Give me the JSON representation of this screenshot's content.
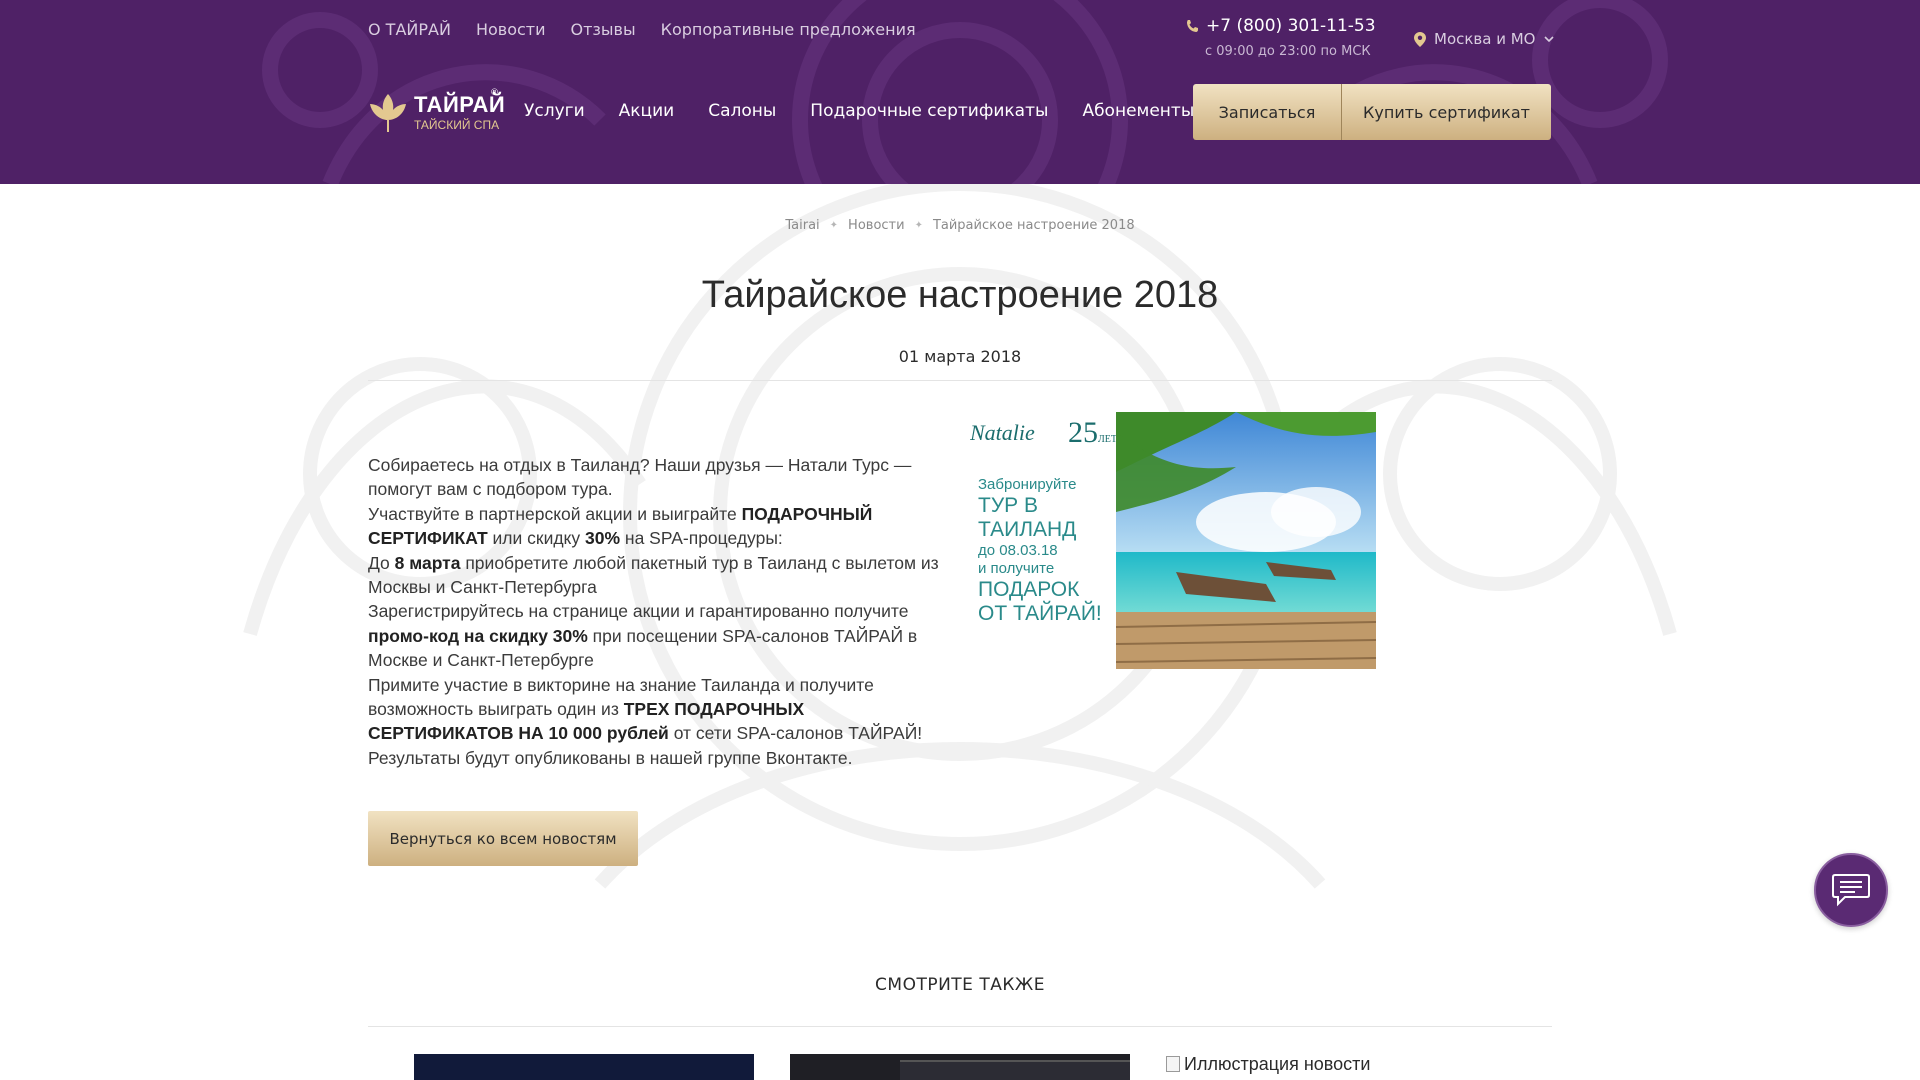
{
  "topnav": {
    "items": [
      "О ТАЙРАЙ",
      "Новости",
      "Отзывы",
      "Корпоративные предложения"
    ]
  },
  "contact": {
    "phone": "+7 (800) 301-11-53",
    "hours": "с 09:00 до 23:00 по МСК",
    "region": "Москва и МО"
  },
  "logo": {
    "title": "ТАЙРАЙ",
    "subtitle": "ТАЙСКИЙ СПА",
    "reg": "®"
  },
  "mainnav": {
    "items": [
      "Услуги",
      "Акции",
      "Салоны",
      "Подарочные сертификаты",
      "Абонементы"
    ]
  },
  "cta": {
    "signup": "Записаться",
    "buy": "Купить сертификат"
  },
  "breadcrumb": {
    "items": [
      "Tairai",
      "Новости",
      "Тайрайское настроение 2018"
    ],
    "separator": "✦"
  },
  "article": {
    "title": "Тайрайское настроение 2018",
    "date": "01 марта 2018",
    "p1": "Собираетесь на отдых в Таиланд? Наши друзья — Натали Турс — помогут вам с подбором тура.",
    "p2_a": "Участвуйте в партнерской акции и выиграйте ",
    "p2_b": "ПОДАРОЧНЫЙ СЕРТИФИКАТ",
    "p2_c": " или скидку ",
    "p2_d": "30%",
    "p2_e": " на SPA-процедуры:",
    "p3_a": "До ",
    "p3_b": "8 марта",
    "p3_c": " приобретите любой пакетный тур в Таиланд с вылетом из Москвы и Санкт-Петербурга",
    "p4_a": "Зарегистрируйтесь на странице акции и гарантированно получите ",
    "p4_b": "промо-код на скидку 30%",
    "p4_c": " при посещении SPA-салонов ТАЙРАЙ в Москве и Санкт-Петербурге",
    "p5_a": "Примите участие в викторине на знание Таиланда и получите возможность выиграть один из ",
    "p5_b": "ТРЕХ ПОДАРОЧНЫХ СЕРТИФИКАТОВ НА 10 000 рублей",
    "p5_c": " от сети SPA-салонов ТАЙРАЙ!",
    "p6": "Результаты будут опубликованы в нашей группе Вконтакте."
  },
  "banner": {
    "brand": "Natalie",
    "years": "25",
    "years_suffix": "ЛЕТ",
    "line1": "Забронируйте",
    "line2": "ТУР В",
    "line3": "ТАИЛАНД",
    "line4": "до 08.03.18",
    "line5": "и получите",
    "line6": "ПОДАРОК",
    "line7": "ОТ ТАЙРАЙ!"
  },
  "back_button": "Вернуться ко всем новостям",
  "see_also": {
    "title": "СМОТРИТЕ ТАКЖЕ",
    "broken_alt": "Иллюстрация новости"
  },
  "colors": {
    "header_bg": "#4f2166",
    "gold": "#d9c29a",
    "chat": "#5a2a73"
  },
  "icons": {
    "phone": "phone-icon",
    "location": "location-pin-icon",
    "chat": "chat-icon"
  }
}
